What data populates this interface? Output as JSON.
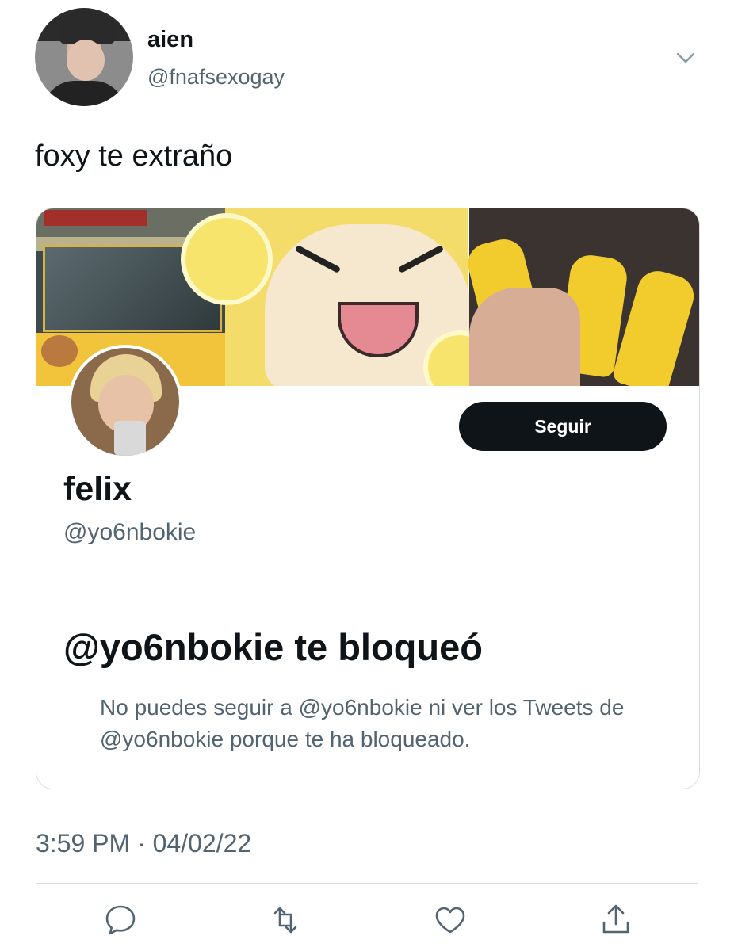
{
  "author": {
    "name": "aien",
    "handle": "@fnafsexogay"
  },
  "tweet": {
    "text": "foxy te extraño",
    "timestamp": "3:59 PM · 04/02/22"
  },
  "card": {
    "profile_name": "felix",
    "profile_handle": "@yo6nbokie",
    "follow_label": "Seguir",
    "blocked_title": "@yo6nbokie te bloqueó",
    "blocked_desc": "No puedes seguir a @yo6nbokie ni ver los Tweets de @yo6nbokie porque te ha bloqueado."
  },
  "icons": {
    "more": "chevron-down-icon",
    "reply": "reply-icon",
    "retweet": "retweet-icon",
    "like": "heart-icon",
    "share": "share-icon"
  },
  "colors": {
    "text": "#0f1419",
    "muted": "#536471",
    "button_bg": "#0f1419",
    "button_text": "#ffffff"
  }
}
